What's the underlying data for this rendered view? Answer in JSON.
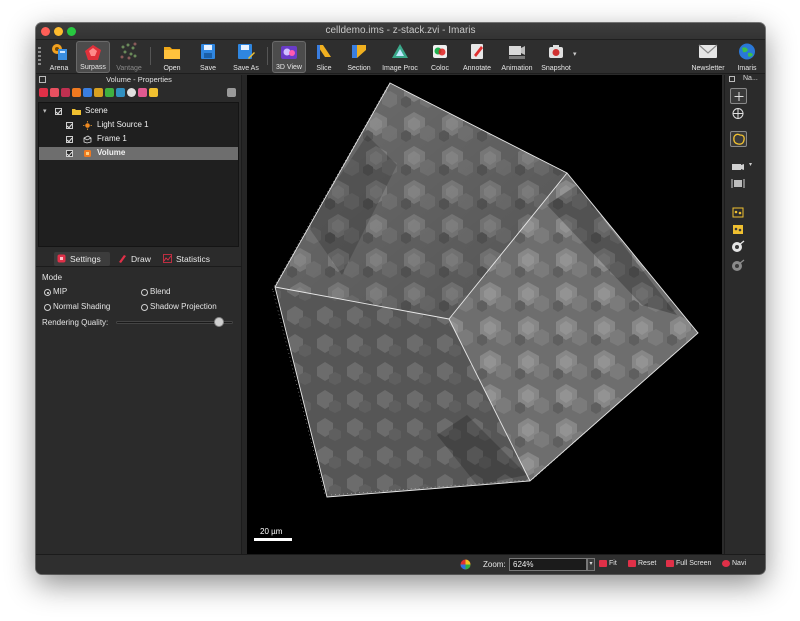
{
  "window": {
    "title": "celldemo.ims - z-stack.zvi - Imaris"
  },
  "toolbar": {
    "items": [
      {
        "label": "Arena",
        "icon": "arena-icon"
      },
      {
        "label": "Surpass",
        "icon": "surpass-icon"
      },
      {
        "label": "Vantage",
        "icon": "vantage-icon"
      },
      {
        "label": "Open",
        "icon": "folder-icon"
      },
      {
        "label": "Save",
        "icon": "save-icon"
      },
      {
        "label": "Save As",
        "icon": "save-as-icon"
      },
      {
        "label": "3D View",
        "icon": "3d-view-icon"
      },
      {
        "label": "Slice",
        "icon": "slice-icon"
      },
      {
        "label": "Section",
        "icon": "section-icon"
      },
      {
        "label": "Image Proc",
        "icon": "image-proc-icon"
      },
      {
        "label": "Coloc",
        "icon": "coloc-icon"
      },
      {
        "label": "Annotate",
        "icon": "annotate-icon"
      },
      {
        "label": "Animation",
        "icon": "animation-icon"
      },
      {
        "label": "Snapshot",
        "icon": "snapshot-icon"
      },
      {
        "label": "Newsletter",
        "icon": "newsletter-icon"
      },
      {
        "label": "Imaris",
        "icon": "imaris-globe-icon"
      }
    ],
    "active": "3D View"
  },
  "properties": {
    "title": "Volume - Properties",
    "tree": [
      {
        "label": "Scene",
        "level": 0,
        "icon": "folder-icon"
      },
      {
        "label": "Light Source 1",
        "level": 1,
        "icon": "light-source-icon"
      },
      {
        "label": "Frame 1",
        "level": 1,
        "icon": "frame-icon"
      },
      {
        "label": "Volume",
        "level": 1,
        "icon": "volume-icon",
        "selected": true
      }
    ],
    "tabs": [
      "Settings",
      "Draw",
      "Statistics"
    ],
    "active_tab": "Settings",
    "settings": {
      "mode_label": "Mode",
      "options": [
        "MIP",
        "Blend",
        "Normal Shading",
        "Shadow Projection"
      ],
      "selected": "MIP",
      "quality_label": "Rendering Quality:",
      "quality_value": 0.88
    }
  },
  "viewport": {
    "scale_label": "20 µm"
  },
  "navi_panel": {
    "title": "Na..."
  },
  "statusbar": {
    "zoom_label": "Zoom:",
    "zoom_value": "624%",
    "buttons": [
      "Fit",
      "Reset",
      "Full Screen",
      "Navi"
    ]
  },
  "colors": {
    "accent_selected": "#6e6e6e",
    "window_bg": "#2b2b2b",
    "viewport_bg": "#000000"
  }
}
